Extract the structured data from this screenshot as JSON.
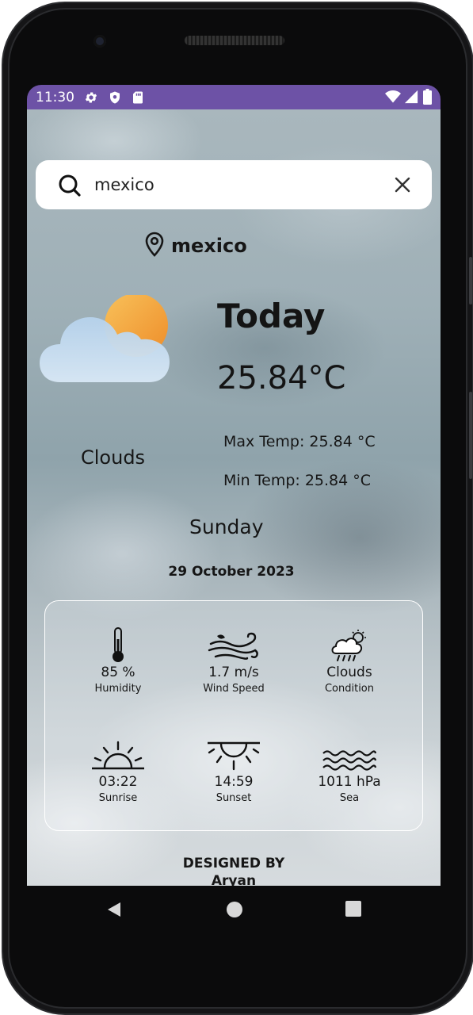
{
  "status_bar": {
    "time": "11:30",
    "left_icons": [
      "gear-icon",
      "shield-icon",
      "sd-card-icon"
    ],
    "right_icons": [
      "wifi-icon",
      "signal-icon",
      "battery-icon"
    ],
    "color": "#6d52a6"
  },
  "search": {
    "value": "mexico",
    "placeholder": ""
  },
  "location": {
    "name": "mexico"
  },
  "weather": {
    "heading": "Today",
    "temperature": "25.84°C",
    "condition": "Clouds",
    "max_temp": "Max Temp: 25.84 °C",
    "min_temp": "Min Temp: 25.84 °C",
    "day": "Sunday",
    "date": "29 October 2023"
  },
  "stats": [
    {
      "icon": "thermometer-icon",
      "value": "85 %",
      "label": "Humidity"
    },
    {
      "icon": "wind-icon",
      "value": "1.7 m/s",
      "label": "Wind Speed"
    },
    {
      "icon": "cloud-rain-sun-icon",
      "value": "Clouds",
      "label": "Condition"
    },
    {
      "icon": "sunrise-icon",
      "value": "03:22",
      "label": "Sunrise"
    },
    {
      "icon": "sunset-icon",
      "value": "14:59",
      "label": "Sunset"
    },
    {
      "icon": "waves-icon",
      "value": "1011 hPa",
      "label": "Sea"
    }
  ],
  "footer": {
    "line1": "DESIGNED BY",
    "line2": "Aryan"
  },
  "nav": [
    "back-icon",
    "home-icon",
    "recents-icon"
  ]
}
